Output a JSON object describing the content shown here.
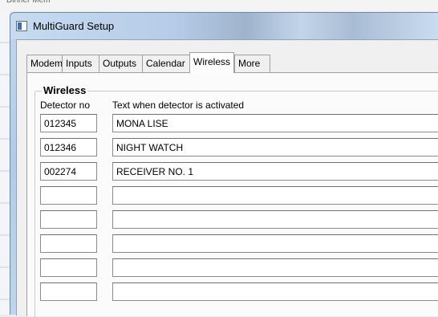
{
  "window": {
    "title": "MultiGuard Setup"
  },
  "tabs": [
    {
      "label": "Modem",
      "selected": false
    },
    {
      "label": "Inputs",
      "selected": false
    },
    {
      "label": "Outputs",
      "selected": false
    },
    {
      "label": "Calendar",
      "selected": false
    },
    {
      "label": "Wireless",
      "selected": true
    },
    {
      "label": "More",
      "selected": false
    }
  ],
  "wireless": {
    "group_title": "Wireless",
    "columns": {
      "detector": "Detector no",
      "text": "Text when detector is activated"
    },
    "rows": [
      {
        "detector": "012345",
        "text": "MONA LISE"
      },
      {
        "detector": "012346",
        "text": "NIGHT WATCH"
      },
      {
        "detector": "002274",
        "text": "RECEIVER NO. 1"
      },
      {
        "detector": "",
        "text": ""
      },
      {
        "detector": "",
        "text": ""
      },
      {
        "detector": "",
        "text": ""
      },
      {
        "detector": "",
        "text": ""
      },
      {
        "detector": "",
        "text": ""
      }
    ]
  }
}
